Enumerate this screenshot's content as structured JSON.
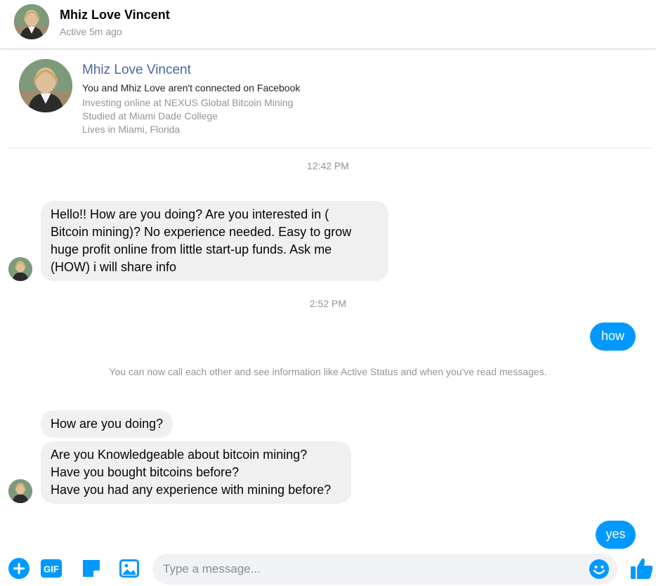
{
  "header": {
    "name": "Mhiz Love Vincent",
    "status": "Active 5m ago"
  },
  "profile": {
    "name": "Mhiz Love Vincent",
    "connection": "You and Mhiz Love aren't connected on Facebook",
    "work": "Investing online at NEXUS Global Bitcoin Mining",
    "education": "Studied at Miami Dade College",
    "location": "Lives in Miami, Florida"
  },
  "conversation": {
    "time1": "12:42 PM",
    "msg1": "Hello!! How are you doing? Are you interested in (\nBitcoin mining)? No experience needed. Easy to grow\nhuge profit online from little start-up funds. Ask me\n(HOW) i will share info",
    "time2": "2:52 PM",
    "out1": "how",
    "system": "You can now call each other and see information like Active Status and when you've read messages.",
    "msg2": "How are you doing?",
    "msg3": "Are you Knowledgeable about bitcoin mining?\nHave you bought bitcoins before?\nHave you had any experience with mining before?",
    "out2": "yes"
  },
  "composer": {
    "placeholder": "Type a message...",
    "gif_label": "GIF",
    "icons": [
      "plus-icon",
      "gif-icon",
      "sticker-icon",
      "photo-icon",
      "emoji-icon",
      "thumbs-up-icon"
    ]
  },
  "colors": {
    "accent": "#0099ff",
    "incoming_bubble": "#f0f0f0",
    "profile_name": "#4b67a1",
    "muted_text": "#90949c"
  }
}
